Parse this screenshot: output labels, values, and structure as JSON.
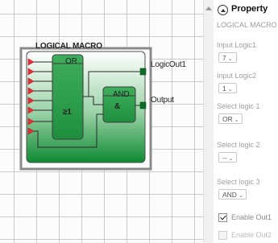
{
  "canvas": {
    "block_title": "LOGICAL MACRO",
    "or_gate": {
      "header": "OR",
      "symbol": "≥1"
    },
    "and_gate": {
      "header": "AND",
      "symbol": "&"
    },
    "outputs": [
      "LogicOut1",
      "Output"
    ],
    "input_count": 8,
    "colors": {
      "block_green": "#1e9a3c",
      "frame_gray": "#8a8a8a",
      "input_red": "#e0303a"
    }
  },
  "panel": {
    "title": "Property",
    "subtitle": "LOGICAL MACRO",
    "fields": [
      {
        "label": "Input Logic1",
        "value": "7"
      },
      {
        "label": "Input Logic2",
        "value": "1"
      },
      {
        "label": "Select logic 1",
        "value": "OR"
      },
      {
        "label": "Select logic 2",
        "value": "--"
      },
      {
        "label": "Select logic 3",
        "value": "AND"
      }
    ],
    "checkboxes": [
      {
        "label": "Enable Out1",
        "checked": true,
        "enabled": true
      },
      {
        "label": "Enable Out2",
        "checked": false,
        "enabled": false
      }
    ]
  }
}
